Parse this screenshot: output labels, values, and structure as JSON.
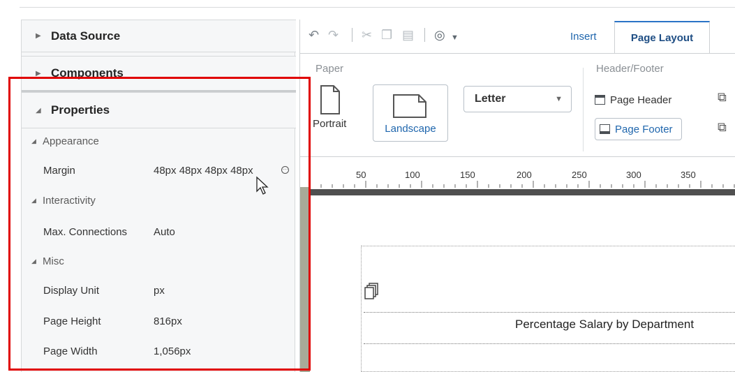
{
  "left_panel": {
    "data_source": "Data Source",
    "components": "Components",
    "properties": "Properties",
    "sections": {
      "appearance": "Appearance",
      "interactivity": "Interactivity",
      "misc": "Misc"
    },
    "props": {
      "margin_label": "Margin",
      "margin_value": "48px 48px 48px 48px",
      "max_conn_label": "Max. Connections",
      "max_conn_value": "Auto",
      "display_unit_label": "Display Unit",
      "display_unit_value": "px",
      "page_height_label": "Page Height",
      "page_height_value": "816px",
      "page_width_label": "Page Width",
      "page_width_value": "1,056px"
    }
  },
  "toolbar": {
    "tab_insert": "Insert",
    "tab_page_layout": "Page Layout"
  },
  "ribbon": {
    "paper_label": "Paper",
    "portrait": "Portrait",
    "landscape": "Landscape",
    "paper_size": "Letter",
    "header_footer_label": "Header/Footer",
    "page_header": "Page Header",
    "page_footer": "Page Footer"
  },
  "ruler": {
    "ticks": [
      "50",
      "100",
      "150",
      "200",
      "250",
      "300",
      "350"
    ]
  },
  "canvas": {
    "report_title": "Percentage Salary by Department"
  },
  "colors": {
    "highlight_box": "#e00000",
    "tab_accent": "#2a73c6",
    "link_blue": "#1f66ad"
  }
}
